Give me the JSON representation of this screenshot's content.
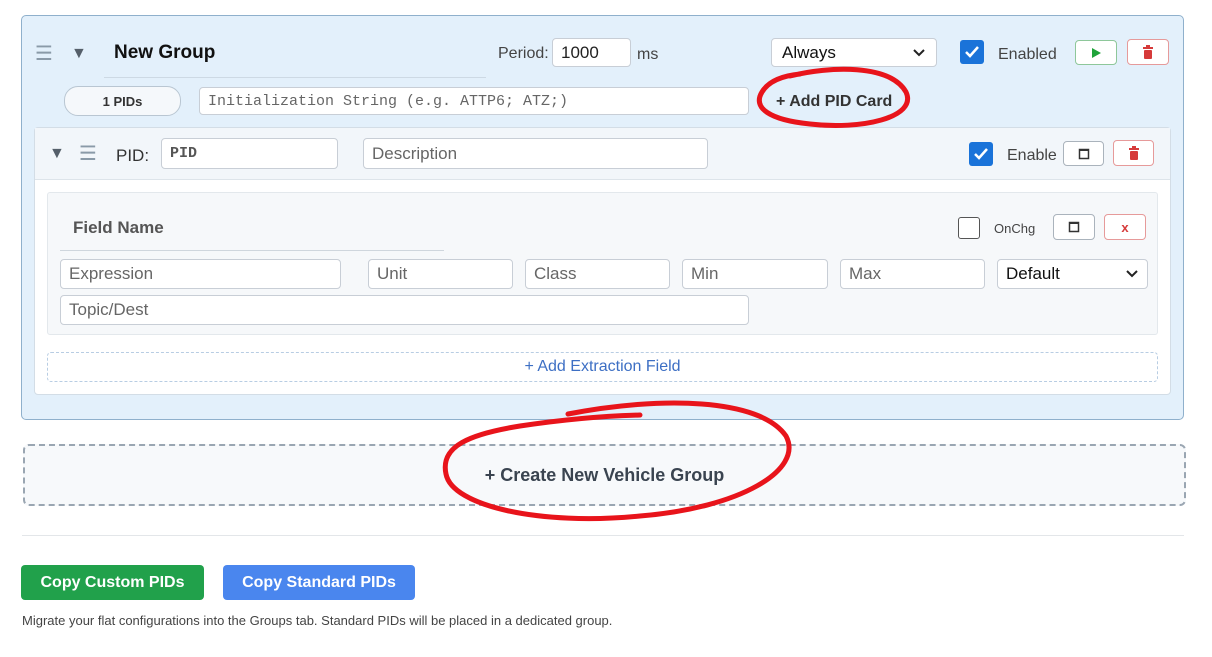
{
  "group": {
    "title": "New Group",
    "period_label": "Period:",
    "period_value": "1000",
    "period_unit": "ms",
    "trigger_selected": "Always",
    "enabled_label": "Enabled",
    "enabled_checked": true,
    "pid_count": "1 PIDs",
    "init_placeholder": "Initialization String (e.g. ATTP6; ATZ;)",
    "add_pid_label": "+ Add PID Card"
  },
  "pid_card": {
    "pid_label": "PID:",
    "pid_placeholder": "PID",
    "description_placeholder": "Description",
    "enable_label": "Enable",
    "enable_checked": true,
    "field": {
      "name_placeholder": "Field Name",
      "onchange_label": "OnChg",
      "onchange_checked": false,
      "remove_label": "x",
      "expression_placeholder": "Expression",
      "unit_placeholder": "Unit",
      "class_placeholder": "Class",
      "min_placeholder": "Min",
      "max_placeholder": "Max",
      "format_selected": "Default",
      "topic_placeholder": "Topic/Dest"
    },
    "add_field_label": "+ Add Extraction Field"
  },
  "create_group_label": "+ Create New Vehicle Group",
  "actions": {
    "copy_custom_label": "Copy Custom PIDs",
    "copy_standard_label": "Copy Standard PIDs",
    "help_text": "Migrate your flat configurations into the Groups tab. Standard PIDs will be placed in a dedicated group."
  },
  "colors": {
    "accent": "#1a73d9",
    "copy_custom_bg": "#21a14b",
    "copy_standard_bg": "#4a86ee",
    "annotation_red": "#e8141b",
    "run_green": "#1fa33a",
    "delete_red": "#d63a3a"
  },
  "icons": [
    "drag-handle-icon",
    "collapse-triangle-icon",
    "play-icon",
    "trash-icon",
    "check-icon",
    "copy-icon",
    "chevron-down-icon"
  ]
}
